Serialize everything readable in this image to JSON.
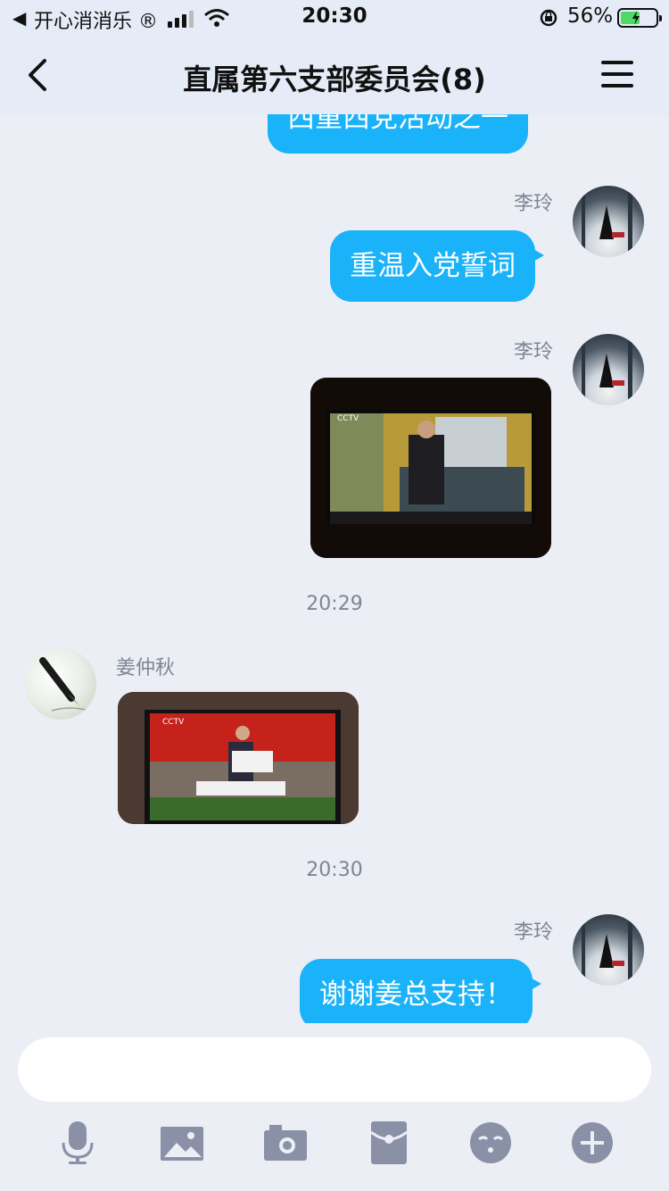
{
  "status_bar": {
    "back_indicator": "◀",
    "carrier": "开心消消乐 ®",
    "time": "20:30",
    "battery_percent": "56%",
    "battery_level": 0.56
  },
  "nav": {
    "title": "直属第六支部委员会(8)",
    "back_icon": "chevron-left-icon",
    "menu_icon": "menu-icon"
  },
  "messages": [
    {
      "type": "text",
      "side": "right",
      "text": "西重西党活动之一"
    },
    {
      "type": "text",
      "side": "right",
      "sender": "李玲",
      "text": "重温入党誓词"
    },
    {
      "type": "image",
      "side": "right",
      "sender": "李玲",
      "caption": "CCTV"
    },
    {
      "type": "timestamp",
      "text": "20:29"
    },
    {
      "type": "image",
      "side": "left",
      "sender": "姜仲秋",
      "caption": "CCTV"
    },
    {
      "type": "timestamp",
      "text": "20:30"
    },
    {
      "type": "text",
      "side": "right",
      "sender": "李玲",
      "text": "谢谢姜总支持！"
    }
  ],
  "input": {
    "placeholder": "",
    "toolbar": [
      "microphone-icon",
      "photo-icon",
      "camera-icon",
      "red-packet-icon",
      "emoji-icon",
      "plus-icon"
    ]
  },
  "colors": {
    "bubble": "#1ab2f8",
    "background": "#eceef6",
    "header": "#e6ecf7",
    "icon_gray": "#8a90a6"
  }
}
